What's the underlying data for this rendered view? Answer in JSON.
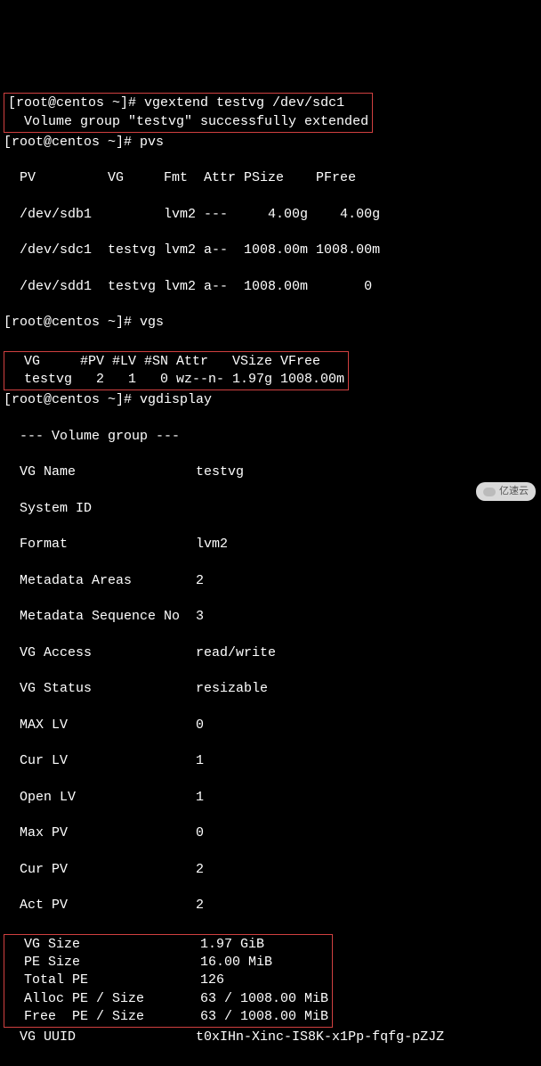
{
  "prompt1": "[root@centos ~]# ",
  "cmd1": "vgextend testvg /dev/sdc1",
  "out1": "  Volume group \"testvg\" successfully extended",
  "prompt2": "[root@centos ~]# ",
  "cmd2": "pvs",
  "pvs_header": "  PV         VG     Fmt  Attr PSize    PFree",
  "pvs_rows": [
    "  /dev/sdb1         lvm2 ---     4.00g    4.00g",
    "  /dev/sdc1  testvg lvm2 a--  1008.00m 1008.00m",
    "  /dev/sdd1  testvg lvm2 a--  1008.00m       0"
  ],
  "prompt3": "[root@centos ~]# ",
  "cmd3": "vgs",
  "vgs_header": "  VG     #PV #LV #SN Attr   VSize VFree",
  "vgs_row": "  testvg   2   1   0 wz--n- 1.97g 1008.00m",
  "prompt4": "[root@centos ~]# ",
  "cmd4": "vgdisplay",
  "vgd_sep": "  --- Volume group ---",
  "vgd_rows_top": [
    "  VG Name               testvg",
    "  System ID",
    "  Format                lvm2",
    "  Metadata Areas        2",
    "  Metadata Sequence No  3",
    "  VG Access             read/write",
    "  VG Status             resizable",
    "  MAX LV                0",
    "  Cur LV                1",
    "  Open LV               1",
    "  Max PV                0",
    "  Cur PV                2",
    "  Act PV                2"
  ],
  "vgd_rows_box": [
    "  VG Size               1.97 GiB",
    "  PE Size               16.00 MiB",
    "  Total PE              126",
    "  Alloc PE / Size       63 / 1008.00 MiB",
    "  Free  PE / Size       63 / 1008.00 MiB"
  ],
  "vgd_uuid": "  VG UUID               t0xIHn-Xinc-IS8K-x1Pp-fqfg-pZJZ",
  "watermark_text": "亿速云",
  "chart_data": {
    "type": "table",
    "pvs": {
      "columns": [
        "PV",
        "VG",
        "Fmt",
        "Attr",
        "PSize",
        "PFree"
      ],
      "rows": [
        {
          "PV": "/dev/sdb1",
          "VG": "",
          "Fmt": "lvm2",
          "Attr": "---",
          "PSize": "4.00g",
          "PFree": "4.00g"
        },
        {
          "PV": "/dev/sdc1",
          "VG": "testvg",
          "Fmt": "lvm2",
          "Attr": "a--",
          "PSize": "1008.00m",
          "PFree": "1008.00m"
        },
        {
          "PV": "/dev/sdd1",
          "VG": "testvg",
          "Fmt": "lvm2",
          "Attr": "a--",
          "PSize": "1008.00m",
          "PFree": "0"
        }
      ]
    },
    "vgs": {
      "columns": [
        "VG",
        "#PV",
        "#LV",
        "#SN",
        "Attr",
        "VSize",
        "VFree"
      ],
      "rows": [
        {
          "VG": "testvg",
          "#PV": 2,
          "#LV": 1,
          "#SN": 0,
          "Attr": "wz--n-",
          "VSize": "1.97g",
          "VFree": "1008.00m"
        }
      ]
    },
    "vgdisplay": {
      "VG Name": "testvg",
      "System ID": "",
      "Format": "lvm2",
      "Metadata Areas": 2,
      "Metadata Sequence No": 3,
      "VG Access": "read/write",
      "VG Status": "resizable",
      "MAX LV": 0,
      "Cur LV": 1,
      "Open LV": 1,
      "Max PV": 0,
      "Cur PV": 2,
      "Act PV": 2,
      "VG Size": "1.97 GiB",
      "PE Size": "16.00 MiB",
      "Total PE": 126,
      "Alloc PE / Size": "63 / 1008.00 MiB",
      "Free  PE / Size": "63 / 1008.00 MiB",
      "VG UUID": "t0xIHn-Xinc-IS8K-x1Pp-fqfg-pZJZ"
    }
  }
}
